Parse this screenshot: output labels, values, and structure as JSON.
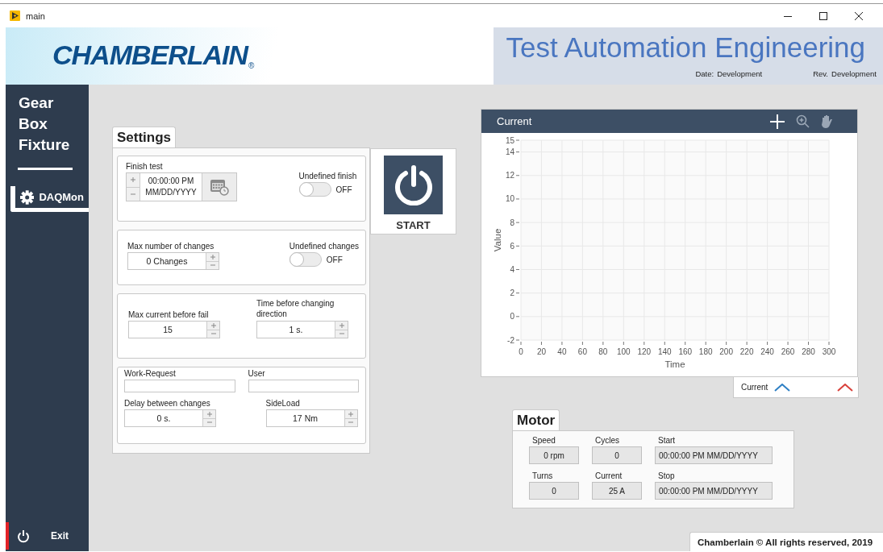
{
  "window": {
    "title": "main"
  },
  "header": {
    "logo": "CHAMBERLAIN",
    "logo_mark": "®",
    "title": "Test Automation Engineering",
    "date_label": "Date:",
    "date_value": "Development",
    "rev_label": "Rev.",
    "rev_value": "Development"
  },
  "sidebar": {
    "title": "Gear Box Fixture",
    "items": [
      {
        "label": "DAQMon",
        "selected": true
      }
    ],
    "exit": "Exit"
  },
  "settings": {
    "tab": "Settings",
    "groups": [
      {
        "items": [
          {
            "kind": "datetime",
            "label": "Finish test",
            "lines": [
              "00:00:00 PM",
              "MM/DD/YYYY"
            ]
          },
          {
            "kind": "toggle",
            "label": "Undefined finish",
            "on": false,
            "state_text": "OFF"
          }
        ]
      },
      {
        "items": [
          {
            "kind": "stepper",
            "label": "Max number of changes",
            "value": "0 Changes"
          },
          {
            "kind": "toggle",
            "label": "Undefined changes",
            "on": false,
            "state_text": "OFF"
          }
        ]
      },
      {
        "items": [
          {
            "kind": "stepper",
            "label": "Max current before fail",
            "value": "15"
          },
          {
            "kind": "stepper",
            "label": "Time before changing direction",
            "value": "1 s."
          }
        ]
      },
      {
        "items": [
          {
            "kind": "text",
            "label": "Work-Request"
          },
          {
            "kind": "text",
            "label": "User"
          },
          {
            "kind": "stepper",
            "label": "Delay between changes",
            "value": "0 s."
          },
          {
            "kind": "stepper",
            "label": "SideLoad",
            "value": "17 Nm"
          }
        ]
      }
    ]
  },
  "start_button": {
    "label": "START"
  },
  "chart": {
    "title": "Current",
    "chart_data": {
      "type": "line",
      "xlabel": "Time",
      "ylabel": "Value",
      "xlim": [
        0,
        300
      ],
      "ylim": [
        -2,
        15
      ],
      "xticks": [
        0,
        20,
        40,
        60,
        80,
        100,
        120,
        140,
        160,
        180,
        200,
        220,
        240,
        260,
        280,
        300
      ],
      "yticks": [
        -2,
        0,
        2,
        4,
        6,
        8,
        10,
        12,
        14,
        15
      ],
      "grid": true
    },
    "legend": [
      {
        "label": "Current",
        "color": "#2f80c4"
      },
      {
        "color": "#d9423c"
      }
    ]
  },
  "motor": {
    "tab": "Motor",
    "fields": [
      {
        "label": "Speed",
        "value": "0 rpm"
      },
      {
        "label": "Cycles",
        "value": "0"
      },
      {
        "label": "Start",
        "value": "00:00:00 PM MM/DD/YYYY"
      },
      {
        "label": "Turns",
        "value": "0"
      },
      {
        "label": "Current",
        "value": "25 A"
      },
      {
        "label": "Stop",
        "value": "00:00:00 PM MM/DD/YYYY"
      }
    ]
  },
  "footer": "Chamberlain © All rights reserved, 2019"
}
